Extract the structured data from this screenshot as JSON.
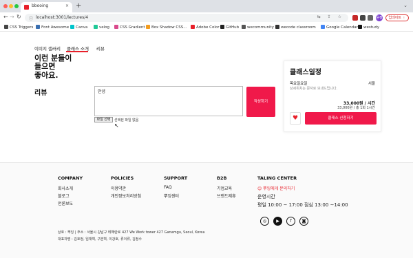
{
  "browser": {
    "tab_title": "bbooing",
    "tab_close": "×",
    "new_tab": "+",
    "tab_expand": "⌄",
    "url": "localhost:3001/lectures/4",
    "back": "←",
    "forward": "→",
    "reload": "↻",
    "lock": "ⓘ",
    "omni_icons": "⇆ ⇪ ☆",
    "avatar": "윤정",
    "update_button": "업데이트 ⋮"
  },
  "bookmarks": [
    {
      "label": "CSS Triggers",
      "color": "#444444"
    },
    {
      "label": "Font Awesome",
      "color": "#3a6fb0"
    },
    {
      "label": "Canva",
      "color": "#00c4cc"
    },
    {
      "label": "velog",
      "color": "#20c997"
    },
    {
      "label": "CSS Gradient",
      "color": "#d94a8c"
    },
    {
      "label": "Box Shadow CSS...",
      "color": "#f29c1f"
    },
    {
      "label": "Adobe Color",
      "color": "#e8202a"
    },
    {
      "label": "GitHub",
      "color": "#222222"
    },
    {
      "label": "wecommunity",
      "color": "#555555"
    },
    {
      "label": "wecode classroom",
      "color": "#333333"
    },
    {
      "label": "Google Calendar",
      "color": "#4285f4"
    },
    {
      "label": "westudy",
      "color": "#111111"
    }
  ],
  "page_tabs": [
    "이미지 갤러리",
    "클래스 소개",
    "리뷰"
  ],
  "intro_lines": [
    "이런 분들이",
    "들으면",
    "좋아요."
  ],
  "review": {
    "title": "리뷰",
    "input_value": "안녕",
    "submit_label": "작성하기",
    "file_button": "파일 선택",
    "file_status": "선택된 파일 없음"
  },
  "schedule": {
    "title": "클래스일정",
    "day": "목요일요일",
    "location": "서울",
    "note": "상세위치는 문자로 보내드립니다.",
    "price": "33,000원 / 시간",
    "total": "33,000원 / 총 1회 1시간",
    "heart": "♥",
    "apply_label": "클래스 신청하기"
  },
  "footer": {
    "columns": [
      {
        "title": "COMPANY",
        "items": [
          "회사소개",
          "블로그",
          "언론보도"
        ]
      },
      {
        "title": "POLICIES",
        "items": [
          "이용약관",
          "개인정보처리방침"
        ]
      },
      {
        "title": "SUPPORT",
        "items": [
          "FAQ",
          "뿌잉센터"
        ]
      },
      {
        "title": "B2B",
        "items": [
          "기업교육",
          "브랜드제휴"
        ]
      }
    ],
    "center": {
      "title": "TALING CENTER",
      "contact": "😊 뿌잉에게 문의하기",
      "hours_label": "운영시간",
      "hours": "평일 10:00 ~ 17:00 점심 13:00 ~14:00"
    },
    "social_icons": [
      "◎",
      "▶",
      "f",
      "◙"
    ],
    "address": "상호 : 뿌잉 | 주소 : 서울시 강남구 테헤란로 427 We Work tower 427 Ganamgu, Seoul, Korea",
    "representatives": "대표자명 : 김호정, 임재혁, 구본혁, 이강호, 류이류, 김정수"
  },
  "colors": {
    "accent": "#f0194a",
    "tab_underline": "#e8202a"
  }
}
